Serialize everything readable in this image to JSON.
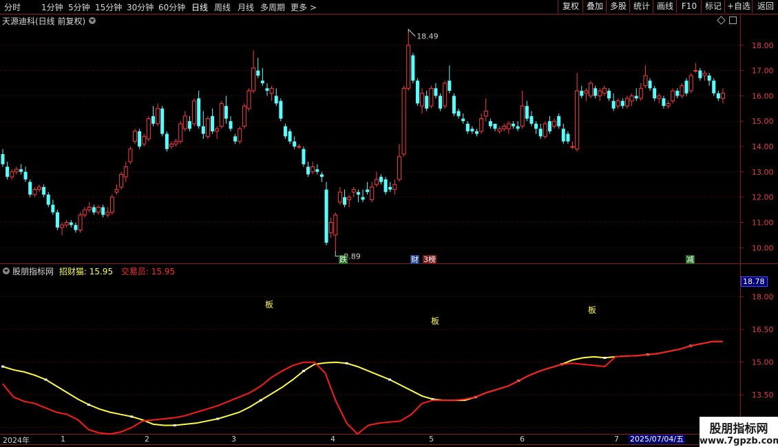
{
  "toolbar": {
    "periods": [
      "分时",
      "1分钟",
      "5分钟",
      "15分钟",
      "30分钟",
      "60分钟",
      "日线",
      "周线",
      "月线",
      "多周期",
      "更多 >"
    ],
    "active_period": "日线",
    "tools": [
      "复权",
      "叠加",
      "多股",
      "统计",
      "画线",
      "F10",
      "标记",
      "+自选",
      "返回"
    ]
  },
  "main_panel": {
    "stock_title": "天源迪科(日线 前复权)",
    "diamond_icon": "diamond-icon",
    "markers": [
      "跌",
      "财",
      "3榜",
      "减"
    ],
    "high_label": "18.49",
    "low_label": "9.89"
  },
  "indicator_panel": {
    "name": "股朋指标网",
    "line1_label": "招财猫:",
    "line1_value": "15.95",
    "line2_label": "交易员:",
    "line2_value": "15.95",
    "current_value": "18.78",
    "annotations": [
      "板",
      "板",
      "板"
    ]
  },
  "x_axis": {
    "labels": [
      "2024年",
      "1",
      "2",
      "3",
      "4",
      "5",
      "6",
      "7"
    ],
    "date_box": "2025/07/04/五"
  },
  "watermark": {
    "title": "股朋指标网",
    "url": "www.7gpzb.com"
  },
  "chart_data": [
    {
      "type": "candlestick",
      "title": "天源迪科(日线 前复权)",
      "ylim": [
        9.6,
        18.7
      ],
      "yticks": [
        10.0,
        11.0,
        12.0,
        13.0,
        14.0,
        15.0,
        16.0,
        17.0,
        18.0
      ],
      "marked_high": 18.49,
      "marked_low": 9.89,
      "ohlc": [
        [
          13.7,
          13.9,
          13.2,
          13.3
        ],
        [
          13.2,
          13.4,
          12.7,
          12.8
        ],
        [
          12.8,
          13.1,
          12.7,
          13.0
        ],
        [
          13.0,
          13.2,
          12.9,
          13.1
        ],
        [
          13.1,
          13.3,
          12.9,
          13.0
        ],
        [
          13.0,
          13.2,
          12.6,
          12.7
        ],
        [
          12.6,
          12.7,
          12.0,
          12.1
        ],
        [
          12.1,
          12.4,
          12.0,
          12.3
        ],
        [
          12.3,
          12.5,
          12.2,
          12.4
        ],
        [
          12.4,
          12.5,
          12.0,
          12.1
        ],
        [
          12.1,
          12.2,
          11.6,
          11.7
        ],
        [
          11.7,
          11.9,
          11.3,
          11.4
        ],
        [
          11.4,
          11.5,
          10.7,
          10.8
        ],
        [
          10.8,
          11.0,
          10.5,
          10.9
        ],
        [
          10.9,
          11.1,
          10.8,
          11.0
        ],
        [
          11.0,
          11.1,
          10.8,
          10.9
        ],
        [
          10.9,
          11.0,
          10.6,
          10.7
        ],
        [
          10.7,
          11.4,
          10.6,
          11.3
        ],
        [
          11.3,
          11.6,
          11.2,
          11.5
        ],
        [
          11.5,
          11.8,
          11.4,
          11.6
        ],
        [
          11.6,
          11.7,
          11.3,
          11.4
        ],
        [
          11.4,
          11.7,
          11.3,
          11.6
        ],
        [
          11.6,
          11.7,
          11.2,
          11.3
        ],
        [
          11.3,
          11.6,
          11.2,
          11.4
        ],
        [
          11.4,
          12.1,
          11.3,
          12.0
        ],
        [
          12.2,
          12.5,
          12.1,
          12.3
        ],
        [
          12.4,
          13.0,
          12.3,
          12.9
        ],
        [
          12.8,
          13.4,
          12.6,
          13.2
        ],
        [
          13.4,
          14.0,
          13.3,
          13.9
        ],
        [
          14.2,
          14.7,
          14.1,
          14.6
        ],
        [
          14.6,
          14.7,
          13.9,
          14.0
        ],
        [
          14.1,
          14.5,
          14.0,
          14.4
        ],
        [
          14.3,
          15.2,
          14.2,
          15.1
        ],
        [
          15.2,
          15.6,
          14.8,
          14.9
        ],
        [
          14.9,
          15.7,
          14.8,
          15.5
        ],
        [
          15.5,
          15.6,
          14.4,
          14.5
        ],
        [
          14.5,
          14.6,
          13.8,
          13.9
        ],
        [
          14.0,
          14.2,
          13.9,
          14.1
        ],
        [
          14.1,
          14.3,
          14.0,
          14.2
        ],
        [
          14.2,
          15.0,
          14.1,
          14.9
        ],
        [
          14.7,
          15.4,
          14.6,
          15.2
        ],
        [
          15.0,
          15.2,
          14.6,
          14.7
        ],
        [
          14.9,
          15.9,
          14.8,
          15.8
        ],
        [
          15.9,
          16.2,
          14.7,
          14.8
        ],
        [
          14.8,
          15.4,
          14.3,
          14.5
        ],
        [
          14.4,
          15.2,
          14.3,
          15.1
        ],
        [
          15.2,
          15.5,
          14.5,
          14.6
        ],
        [
          14.6,
          14.8,
          14.3,
          14.7
        ],
        [
          14.8,
          15.8,
          14.7,
          15.7
        ],
        [
          15.6,
          16.0,
          14.9,
          15.1
        ],
        [
          15.0,
          15.2,
          14.6,
          14.7
        ],
        [
          14.4,
          14.5,
          14.1,
          14.2
        ],
        [
          14.2,
          14.8,
          14.1,
          14.7
        ],
        [
          14.8,
          15.7,
          14.7,
          15.6
        ],
        [
          15.5,
          16.3,
          15.4,
          16.2
        ],
        [
          16.2,
          17.8,
          16.1,
          17.1
        ],
        [
          17.0,
          17.5,
          16.7,
          16.8
        ],
        [
          16.6,
          17.1,
          16.4,
          16.5
        ],
        [
          16.3,
          16.5,
          16.0,
          16.2
        ],
        [
          16.1,
          16.4,
          15.8,
          16.3
        ],
        [
          16.0,
          16.3,
          15.6,
          15.7
        ],
        [
          15.8,
          15.9,
          15.0,
          15.1
        ],
        [
          14.8,
          14.9,
          14.3,
          14.4
        ],
        [
          14.6,
          14.7,
          14.1,
          14.2
        ],
        [
          14.2,
          14.4,
          13.9,
          14.0
        ],
        [
          14.0,
          14.1,
          13.9,
          14.0
        ],
        [
          13.9,
          14.0,
          13.2,
          13.3
        ],
        [
          13.2,
          13.4,
          12.8,
          12.9
        ],
        [
          13.0,
          13.4,
          12.9,
          13.2
        ],
        [
          13.1,
          13.3,
          12.9,
          13.0
        ],
        [
          12.9,
          13.0,
          12.6,
          12.8
        ],
        [
          12.3,
          12.6,
          10.1,
          10.2
        ],
        [
          10.6,
          11.2,
          10.4,
          11.0
        ],
        [
          10.5,
          11.4,
          9.89,
          11.3
        ],
        [
          11.8,
          12.4,
          11.7,
          12.2
        ],
        [
          12.0,
          12.3,
          11.6,
          11.7
        ],
        [
          11.9,
          12.1,
          11.6,
          12.0
        ],
        [
          12.2,
          12.4,
          12.0,
          12.3
        ],
        [
          12.2,
          12.3,
          11.8,
          12.1
        ],
        [
          12.0,
          12.3,
          11.8,
          11.9
        ],
        [
          12.3,
          12.6,
          12.1,
          12.2
        ],
        [
          11.9,
          12.6,
          11.8,
          12.4
        ],
        [
          12.5,
          13.0,
          12.4,
          12.7
        ],
        [
          12.8,
          12.9,
          12.5,
          12.6
        ],
        [
          12.7,
          12.8,
          12.1,
          12.2
        ],
        [
          12.4,
          12.6,
          12.2,
          12.3
        ],
        [
          12.3,
          12.7,
          12.1,
          12.5
        ],
        [
          12.7,
          14.1,
          12.6,
          13.6
        ],
        [
          13.7,
          16.4,
          13.6,
          16.3
        ],
        [
          16.3,
          18.49,
          16.2,
          18.0
        ],
        [
          17.6,
          17.7,
          16.5,
          16.6
        ],
        [
          16.6,
          16.7,
          15.6,
          15.7
        ],
        [
          15.6,
          16.3,
          15.3,
          16.1
        ],
        [
          16.0,
          16.2,
          15.4,
          15.5
        ],
        [
          15.6,
          16.4,
          15.5,
          16.3
        ],
        [
          16.3,
          16.5,
          15.9,
          16.0
        ],
        [
          16.0,
          16.1,
          15.4,
          15.5
        ],
        [
          15.6,
          16.6,
          15.5,
          16.5
        ],
        [
          16.6,
          17.2,
          16.1,
          16.2
        ],
        [
          16.0,
          16.1,
          15.2,
          15.3
        ],
        [
          15.4,
          15.5,
          15.1,
          15.2
        ],
        [
          15.1,
          15.3,
          14.9,
          15.0
        ],
        [
          14.9,
          15.0,
          14.5,
          14.6
        ],
        [
          14.7,
          14.8,
          14.5,
          14.6
        ],
        [
          14.6,
          14.7,
          14.4,
          14.5
        ],
        [
          14.6,
          15.3,
          14.5,
          15.1
        ],
        [
          15.2,
          15.9,
          15.0,
          15.4
        ],
        [
          15.0,
          15.1,
          14.7,
          14.8
        ],
        [
          14.9,
          14.9,
          14.6,
          14.7
        ],
        [
          14.6,
          14.8,
          14.5,
          14.7
        ],
        [
          14.7,
          14.9,
          14.6,
          14.8
        ],
        [
          14.7,
          15.0,
          14.5,
          14.9
        ],
        [
          14.9,
          15.0,
          14.7,
          14.8
        ],
        [
          14.8,
          15.0,
          14.6,
          14.7
        ],
        [
          14.8,
          16.2,
          14.7,
          15.6
        ],
        [
          15.6,
          15.8,
          15.0,
          15.1
        ],
        [
          15.2,
          15.4,
          14.8,
          14.9
        ],
        [
          14.9,
          15.0,
          14.5,
          14.7
        ],
        [
          14.7,
          14.9,
          14.3,
          14.4
        ],
        [
          14.4,
          15.0,
          14.3,
          14.9
        ],
        [
          15.0,
          15.2,
          14.5,
          14.6
        ],
        [
          14.8,
          15.1,
          14.7,
          15.0
        ],
        [
          15.2,
          15.3,
          14.7,
          14.8
        ],
        [
          14.7,
          14.9,
          14.1,
          14.2
        ],
        [
          14.5,
          14.6,
          14.1,
          14.2
        ],
        [
          14.0,
          14.2,
          13.9,
          14.0
        ],
        [
          13.9,
          16.9,
          13.8,
          16.2
        ],
        [
          16.2,
          16.4,
          15.9,
          16.0
        ],
        [
          16.1,
          16.3,
          15.8,
          16.2
        ],
        [
          16.0,
          16.6,
          15.9,
          16.5
        ],
        [
          16.3,
          16.4,
          15.9,
          16.0
        ],
        [
          16.0,
          16.3,
          15.8,
          16.2
        ],
        [
          16.1,
          16.4,
          16.0,
          16.3
        ],
        [
          16.2,
          16.3,
          15.8,
          15.9
        ],
        [
          15.8,
          16.1,
          15.4,
          15.5
        ],
        [
          15.6,
          15.9,
          15.5,
          15.8
        ],
        [
          15.8,
          15.9,
          15.5,
          15.6
        ],
        [
          15.6,
          16.0,
          15.5,
          15.9
        ],
        [
          15.8,
          16.1,
          15.6,
          16.0
        ],
        [
          16.0,
          16.3,
          15.8,
          15.9
        ],
        [
          15.9,
          16.5,
          15.8,
          16.3
        ],
        [
          16.4,
          17.2,
          16.3,
          16.8
        ],
        [
          16.6,
          16.7,
          16.2,
          16.3
        ],
        [
          16.3,
          16.4,
          15.8,
          15.9
        ],
        [
          15.9,
          16.1,
          15.7,
          16.0
        ],
        [
          15.9,
          16.0,
          15.5,
          15.6
        ],
        [
          15.6,
          15.8,
          15.5,
          15.7
        ],
        [
          15.8,
          16.3,
          15.7,
          16.2
        ],
        [
          16.2,
          16.3,
          15.9,
          16.0
        ],
        [
          16.0,
          16.5,
          15.9,
          16.4
        ],
        [
          16.6,
          16.7,
          16.0,
          16.1
        ],
        [
          16.2,
          16.9,
          16.1,
          16.8
        ],
        [
          17.0,
          17.3,
          16.9,
          17.0
        ],
        [
          17.0,
          17.1,
          16.6,
          16.7
        ],
        [
          16.8,
          17.0,
          16.6,
          16.9
        ],
        [
          16.8,
          16.9,
          16.4,
          16.6
        ],
        [
          16.6,
          16.7,
          16.0,
          16.1
        ],
        [
          16.1,
          16.2,
          15.8,
          15.9
        ],
        [
          15.9,
          16.3,
          15.7,
          16.1
        ]
      ]
    },
    {
      "type": "line",
      "title": "股朋指标网",
      "ylim": [
        11.8,
        19.0
      ],
      "yticks": [
        12.0,
        13.5,
        15.0,
        16.5,
        18.0
      ],
      "series": [
        {
          "name": "招财猫",
          "color": "#ffff3c",
          "values": [
            14.8,
            14.65,
            14.55,
            14.4,
            14.2,
            13.9,
            13.6,
            13.3,
            13.05,
            12.85,
            12.7,
            12.6,
            12.5,
            12.35,
            12.15,
            12.1,
            12.1,
            12.15,
            12.2,
            12.3,
            12.4,
            12.55,
            12.7,
            12.95,
            13.25,
            13.55,
            13.85,
            14.2,
            14.6,
            14.9,
            14.97,
            15.0,
            14.95,
            14.8,
            14.6,
            14.4,
            14.2,
            13.95,
            13.7,
            13.45,
            13.3,
            13.25,
            13.25,
            13.25,
            13.4,
            13.6,
            13.75,
            13.9,
            14.15,
            14.4,
            14.6,
            14.75,
            14.9,
            15.1,
            15.2,
            15.25,
            15.2,
            15.25,
            15.28,
            15.3,
            15.35,
            15.4,
            15.5,
            15.6,
            15.75,
            15.85,
            15.95,
            15.95
          ]
        },
        {
          "name": "交易员",
          "color": "#ff1a1a",
          "values": [
            14.0,
            13.4,
            13.2,
            13.1,
            12.9,
            12.7,
            12.6,
            12.35,
            11.9,
            11.75,
            11.7,
            11.8,
            12.0,
            12.3,
            12.35,
            12.4,
            12.45,
            12.55,
            12.7,
            12.85,
            13.0,
            13.2,
            13.4,
            13.6,
            13.9,
            14.3,
            14.6,
            14.85,
            15.0,
            15.0,
            14.5,
            13.2,
            12.2,
            11.7,
            12.1,
            12.2,
            12.25,
            12.3,
            12.6,
            13.1,
            13.25,
            13.25,
            13.25,
            13.3,
            13.4,
            13.6,
            13.75,
            13.9,
            14.15,
            14.4,
            14.6,
            14.75,
            14.9,
            14.95,
            14.9,
            14.85,
            14.8,
            15.25,
            15.28,
            15.3,
            15.35,
            15.4,
            15.5,
            15.6,
            15.75,
            15.85,
            15.95,
            15.95
          ]
        }
      ]
    }
  ]
}
